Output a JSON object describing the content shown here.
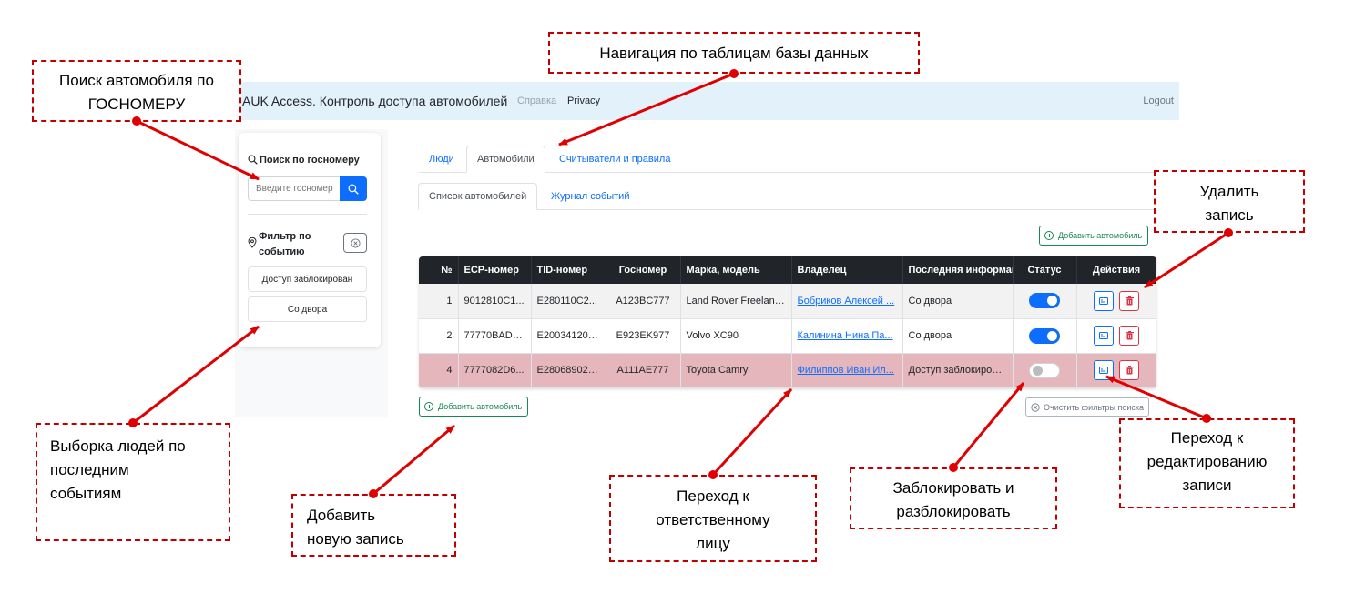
{
  "navbar": {
    "brand": "AUK Access. Контроль доступа автомобилей",
    "links": [
      "Справка",
      "Privacy"
    ],
    "logout": "Logout"
  },
  "sidebar": {
    "search_title": "Поиск по госномеру",
    "search_placeholder": "Введите госномер",
    "filter_title_line1": "Фильтр по",
    "filter_title_line2": "событию",
    "filter_buttons": [
      "Доступ заблокирован",
      "Со двора"
    ]
  },
  "tabs": {
    "main": [
      "Люди",
      "Автомобили",
      "Считыватели и правила"
    ],
    "sub": [
      "Список автомобилей",
      "Журнал событий"
    ]
  },
  "add_button_label": "Добавить автомобиль",
  "table": {
    "headers": [
      "№",
      "ECP-номер",
      "TID-номер",
      "Госномер",
      "Марка, модель",
      "Владелец",
      "Последняя информация",
      "Статус",
      "Действия"
    ],
    "rows": [
      {
        "num": "1",
        "ecp": "9012810C1...",
        "tid": "E280110C2...",
        "plate": "A123BC777",
        "model": "Land Rover Freelander",
        "owner": "Бобриков Алексей ...",
        "last": "Со двора",
        "status": "on"
      },
      {
        "num": "2",
        "ecp": "77770BADD...",
        "tid": "E200341201...",
        "plate": "E923EK977",
        "model": "Volvo XC90",
        "owner": "Калинина Нина Па...",
        "last": "Со двора",
        "status": "on"
      },
      {
        "num": "4",
        "ecp": "7777082D6...",
        "tid": "E280689020...",
        "plate": "A111AE777",
        "model": "Toyota Camry",
        "owner": "Филиппов Иван Ил...",
        "last": "Доступ заблокирован",
        "status": "off"
      }
    ]
  },
  "clear_filters_label": "Очистить фильтры поиска",
  "annotations": {
    "search_line1": "Поиск автомобиля по",
    "search_line2": "ГОСНОМЕРУ",
    "nav": "Навигация по таблицам базы данных",
    "delete_line1": "Удалить",
    "delete_line2": "запись",
    "filter_line1": "Выборка людей по",
    "filter_line2": "последним",
    "filter_line3": "событиям",
    "add_line1": "Добавить",
    "add_line2": "новую запись",
    "owner_line1": "Переход к",
    "owner_line2": "ответственному",
    "owner_line3": "лицу",
    "block_line1": "Заблокировать и",
    "block_line2": "разблокировать",
    "edit_line1": "Переход к",
    "edit_line2": "редактированию",
    "edit_line3": "записи"
  },
  "colors": {
    "accent": "#0d6efd",
    "success": "#198754",
    "danger": "#dc3545",
    "annotation": "#e00000",
    "blocked_row": "#e5b6bc",
    "navbar_bg": "#e3f1fb",
    "table_header": "#212529"
  },
  "icons": [
    "search-icon",
    "map-pin-icon",
    "circle-x-icon",
    "plus-circle-icon",
    "edit-icon",
    "trash-icon"
  ]
}
